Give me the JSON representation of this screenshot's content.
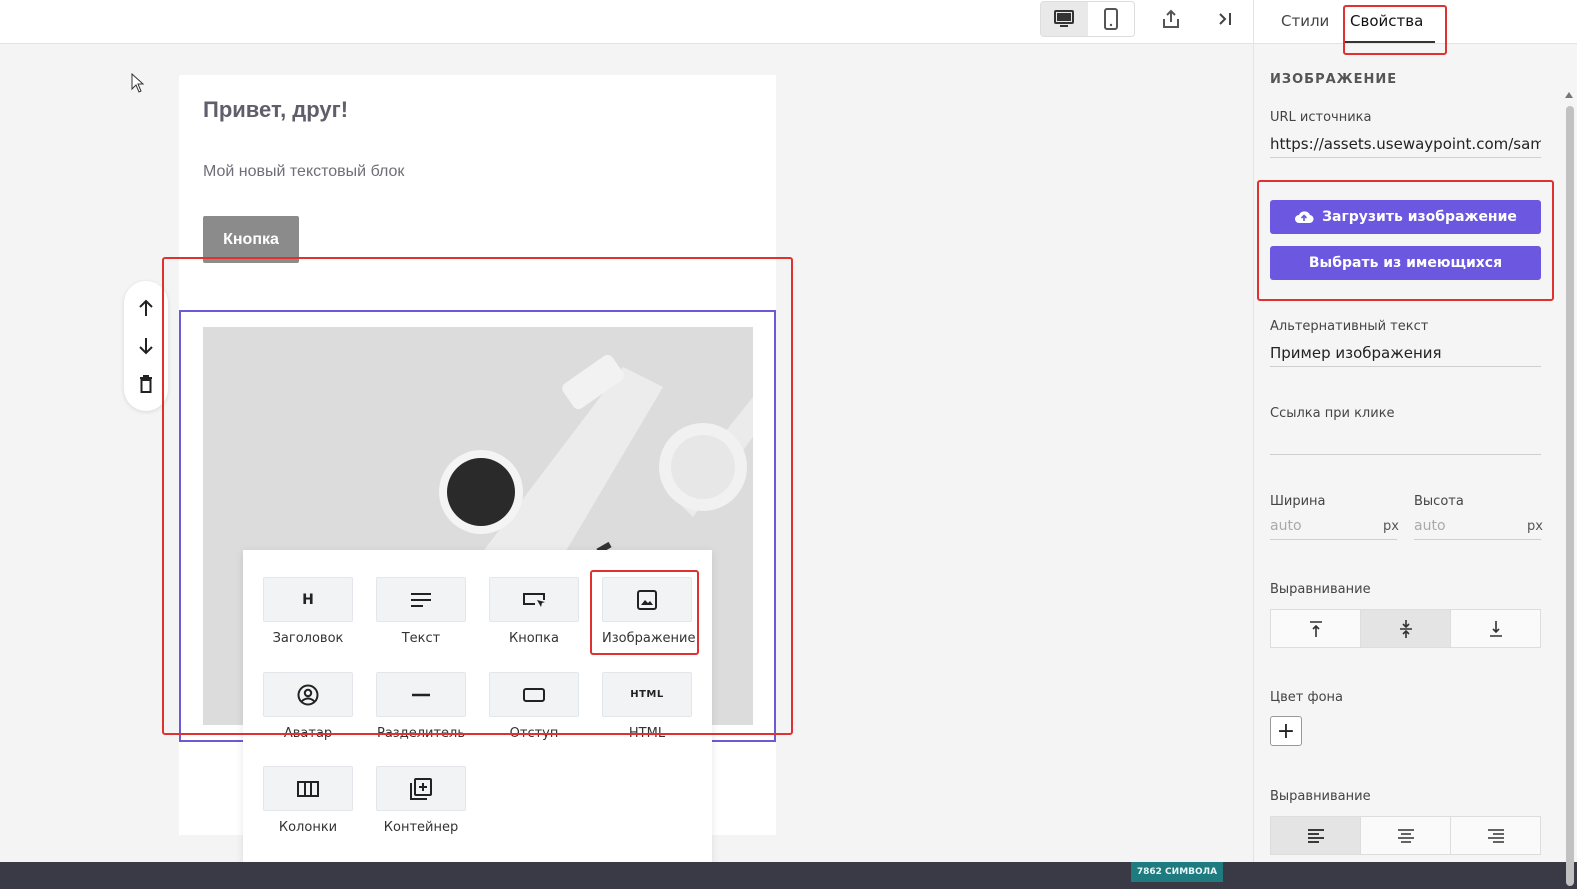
{
  "email": {
    "heading": "Привет, друг!",
    "text": "Мой новый текстовый блок",
    "button": "Кнопка"
  },
  "palette": {
    "items": [
      {
        "label": "Заголовок",
        "icon": "heading-icon"
      },
      {
        "label": "Текст",
        "icon": "text-icon"
      },
      {
        "label": "Кнопка",
        "icon": "button-icon"
      },
      {
        "label": "Изображение",
        "icon": "image-icon"
      },
      {
        "label": "Аватар",
        "icon": "avatar-icon"
      },
      {
        "label": "Разделитель",
        "icon": "divider-icon"
      },
      {
        "label": "Отступ",
        "icon": "spacer-icon"
      },
      {
        "label": "HTML",
        "icon": "html-icon"
      },
      {
        "label": "Колонки",
        "icon": "columns-icon"
      },
      {
        "label": "Контейнер",
        "icon": "container-icon"
      }
    ]
  },
  "panel": {
    "tabs": [
      "Стили",
      "Свойства"
    ],
    "section": "ИЗОБРАЖЕНИЕ",
    "url_label": "URL источника",
    "url_value": "https://assets.usewaypoint.com/sample-image.jpg",
    "upload_button": "Загрузить изображение",
    "choose_button": "Выбрать из имеющихся",
    "alt_label": "Альтернативный текст",
    "alt_value": "Пример изображения",
    "link_label": "Ссылка при клике",
    "width_label": "Ширина",
    "width_placeholder": "auto",
    "height_label": "Высота",
    "height_placeholder": "auto",
    "unit": "px",
    "valign_label": "Выравнивание",
    "bg_label": "Цвет фона",
    "halign_label": "Выравнивание"
  },
  "status": {
    "counter": "7862 СИМВОЛА"
  },
  "colors": {
    "accent": "#6b57e0",
    "highlight": "#e03131"
  }
}
